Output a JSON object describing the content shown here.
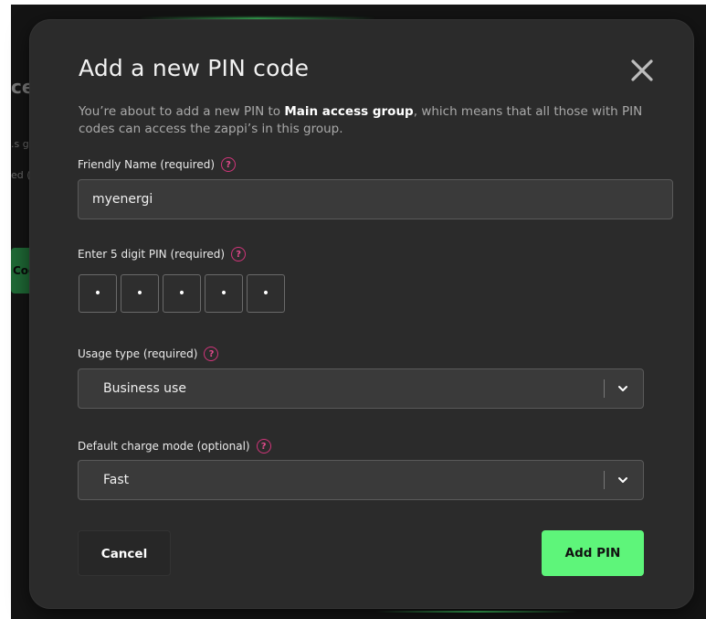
{
  "background": {
    "heading_fragment": "ce",
    "text_fragments": [
      ".s gr",
      "ed ("
    ],
    "button_fragment": "Coo"
  },
  "modal": {
    "title": "Add a new PIN code",
    "intro": {
      "prefix": "You’re about to add a new PIN to ",
      "group_name": "Main access group",
      "suffix": ", which means that all those with PIN codes can access the zappi’s in this group."
    },
    "friendly_name": {
      "label": "Friendly Name (required)",
      "value": "myenergi"
    },
    "pin": {
      "label": "Enter 5 digit PIN (required)",
      "digits": [
        "•",
        "•",
        "•",
        "•",
        "•"
      ]
    },
    "usage_type": {
      "label": "Usage type (required)",
      "selected": "Business use"
    },
    "charge_mode": {
      "label": "Default charge mode (optional)",
      "selected": "Fast"
    },
    "help_glyph": "?",
    "buttons": {
      "cancel": "Cancel",
      "add": "Add PIN"
    }
  },
  "icons": {
    "close": "close-icon",
    "help": "help-icon",
    "chevron": "chevron-down-icon"
  },
  "colors": {
    "accent_green": "#5ef57a",
    "help_pink": "#d1357a",
    "modal_bg": "#2b2b2b",
    "input_bg": "#3a3a3a"
  }
}
